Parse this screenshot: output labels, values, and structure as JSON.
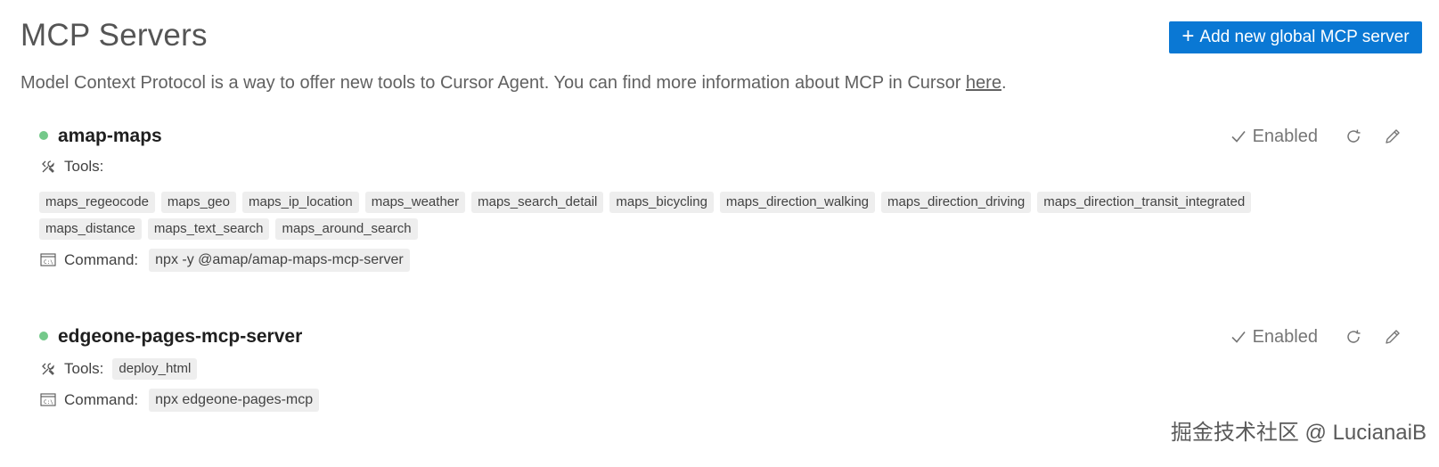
{
  "header": {
    "title": "MCP Servers",
    "add_button_label": "Add new global MCP server",
    "add_button_icon": "plus-icon",
    "description_text": "Model Context Protocol is a way to offer new tools to Cursor Agent. You can find more information about MCP in Cursor ",
    "description_link": "here",
    "description_end": "."
  },
  "servers": [
    {
      "name": "amap-maps",
      "status_color": "#74c98a",
      "enabled_label": "Enabled",
      "tools_label": "Tools:",
      "tools": [
        "maps_regeocode",
        "maps_geo",
        "maps_ip_location",
        "maps_weather",
        "maps_search_detail",
        "maps_bicycling",
        "maps_direction_walking",
        "maps_direction_driving",
        "maps_direction_transit_integrated",
        "maps_distance",
        "maps_text_search",
        "maps_around_search"
      ],
      "command_label": "Command:",
      "command": "npx -y @amap/amap-maps-mcp-server"
    },
    {
      "name": "edgeone-pages-mcp-server",
      "status_color": "#74c98a",
      "enabled_label": "Enabled",
      "tools_label": "Tools:",
      "tools": [
        "deploy_html"
      ],
      "command_label": "Command:",
      "command": "npx edgeone-pages-mcp"
    }
  ],
  "watermark": "掘金技术社区 @ LucianaiB",
  "colors": {
    "accent": "#0a78d4",
    "status_enabled": "#74c98a",
    "chip_bg": "#eeeeee"
  }
}
